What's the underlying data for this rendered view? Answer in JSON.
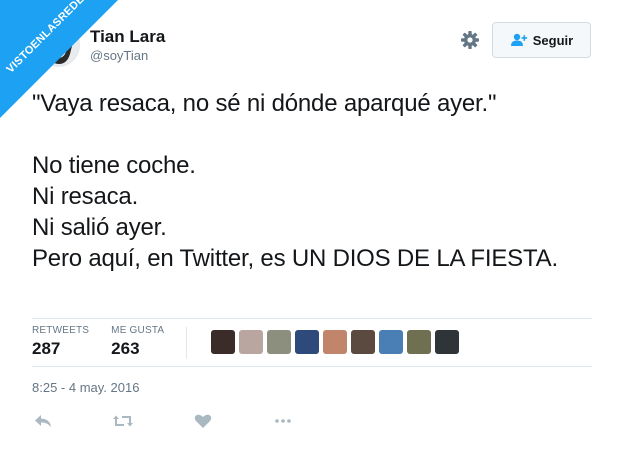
{
  "watermark": {
    "text": "VISTOENLASREDES"
  },
  "header": {
    "display_name": "Tian Lara",
    "username": "@soyTian",
    "follow_label": "Seguir"
  },
  "tweet": {
    "text": "\"Vaya resaca, no sé ni dónde aparqué ayer.\"\n\nNo tiene coche.\nNi resaca.\nNi salió ayer.\nPero aquí, en Twitter, es UN DIOS DE LA FIESTA."
  },
  "stats": {
    "retweets_label": "RETWEETS",
    "retweets_value": "287",
    "likes_label": "ME GUSTA",
    "likes_value": "263"
  },
  "liker_avatar_colors": [
    "#3b2c2a",
    "#b9a6a0",
    "#8d8f7e",
    "#2d4a7a",
    "#c0856a",
    "#5b4a3f",
    "#4a7fb5",
    "#6f6f52",
    "#2f3438"
  ],
  "timestamp": "8:25 - 4 may. 2016",
  "colors": {
    "accent": "#1da1f2",
    "text": "#14171a",
    "muted": "#657786",
    "icon": "#aab8c2"
  }
}
